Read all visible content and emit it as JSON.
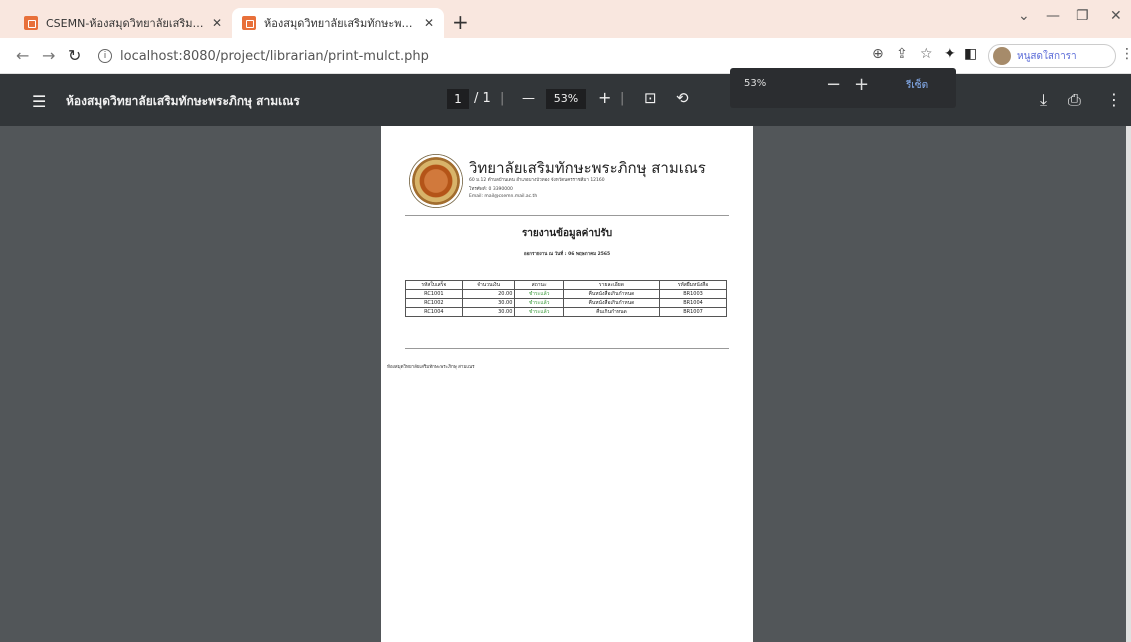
{
  "browser": {
    "tabs": [
      {
        "title": "CSEMN-ห้องสมุดวิทยาลัยเสริมทักษะ"
      },
      {
        "title": "ห้องสมุดวิทยาลัยเสริมทักษะพระภิกษุ ส"
      }
    ],
    "url": "localhost:8080/project/librarian/print-mulct.php",
    "profile_name": "หนูสดใสการา"
  },
  "pdf_toolbar": {
    "title": "ห้องสมุดวิทยาลัยเสริมทักษะพระภิกษุ สามเณร",
    "current_page": "1",
    "total_pages": "/ 1",
    "zoom": "53%",
    "zoom_popup": {
      "value": "53%",
      "reset_label": "รีเซ็ต"
    }
  },
  "document": {
    "org_name": "วิทยาลัยเสริมทักษะพระภิกษุ สามเณร",
    "address_lines": [
      "60 ม.12 ตำบลบ้านเดน อำเภอบางบัวทอง จังหวัดนครราชสีมา 12160",
      "โทรศัพท์: 0 3390000",
      "Email: mail@csemn.mail.ac.th"
    ],
    "report_title": "รายงานข้อมูลค่าปรับ",
    "report_date": "ออกรายงาน ณ วันที่ : 06 พฤษภาคม 2565",
    "table": {
      "headers": [
        "รหัสใบเสร็จ",
        "จำนวนเงิน",
        "สถานะ",
        "รายละเอียด",
        "รหัสยืมหนังสือ"
      ],
      "rows": [
        [
          "RC1001",
          "20.00",
          "ชำระแล้ว",
          "คืนหนังสือเกินกำหนด",
          "BR1003"
        ],
        [
          "RC1002",
          "30.00",
          "ชำระแล้ว",
          "คืนหนังสือเกินกำหนด",
          "BR1004"
        ],
        [
          "RC1004",
          "30.00",
          "ชำระแล้ว",
          "คืนเกินกำหนด",
          "BR1007"
        ]
      ]
    },
    "footer": "ห้องสมุดวิทยาลัยเสริมทักษะพระภิกษุ สามเณร"
  }
}
